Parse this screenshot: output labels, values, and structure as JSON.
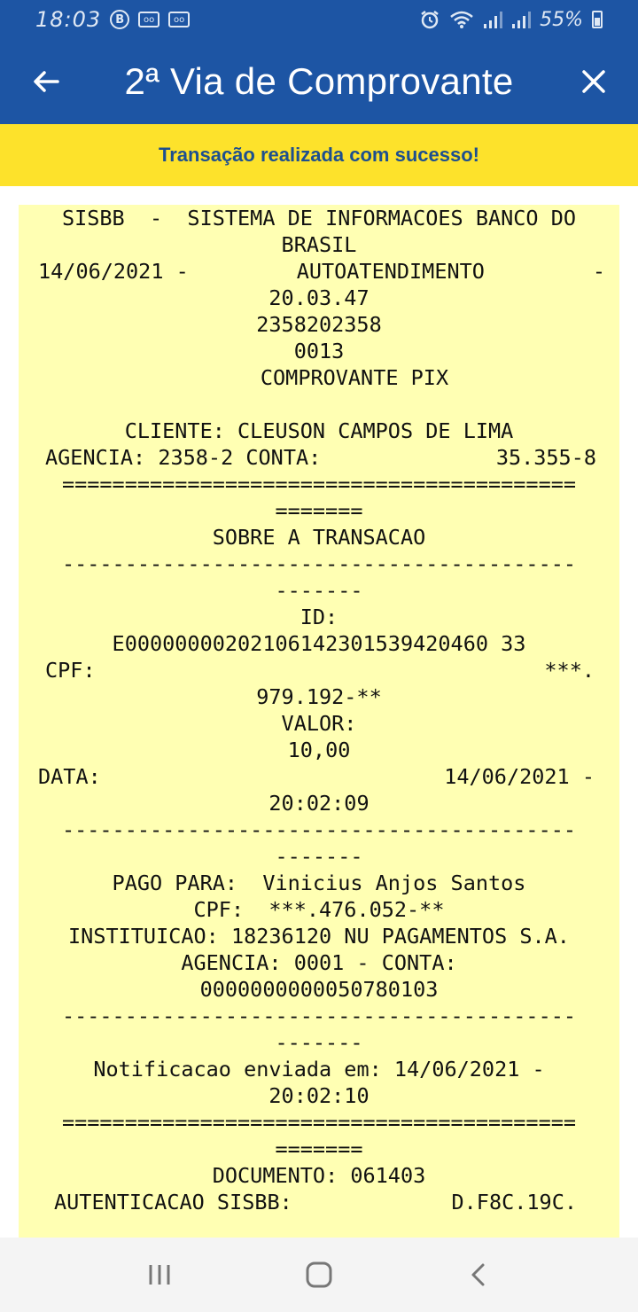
{
  "status_bar": {
    "time": "18:03",
    "battery": "55%",
    "icons": [
      "b-circle-icon",
      "voicemail-1-icon",
      "voicemail-2-icon",
      "alarm-icon",
      "wifi-icon",
      "signal-1-icon",
      "signal-2-icon",
      "battery-icon"
    ]
  },
  "header": {
    "title": "2ª Via de Comprovante",
    "back_icon": "arrow-left-icon",
    "close_icon": "close-icon",
    "bg_color": "#1d55a4"
  },
  "banner": {
    "text": "Transação realizada com sucesso!",
    "bg_color": "#fde22b",
    "text_color": "#1d4f8f"
  },
  "receipt": {
    "bg_color": "#ffffb3",
    "l01": "SISBB  -  SISTEMA DE INFORMACOES BANCO DO",
    "l02": "BRASIL",
    "l03a": "14/06/2021 -",
    "l03b": "AUTOATENDIMENTO",
    "l03c": "-",
    "l04": "20.03.47",
    "l05": "2358202358",
    "l06": "0013",
    "l07": "COMPROVANTE PIX",
    "l09": "CLIENTE: CLEUSON CAMPOS DE LIMA",
    "l10a": "AGENCIA: 2358-2 CONTA:",
    "l10b": "35.355-8",
    "l11": "=========================================",
    "l12": "=======",
    "l13": "SOBRE A TRANSACAO",
    "l14": "-----------------------------------------",
    "l15": "-------",
    "l16": "ID:",
    "l17": "E00000000202106142301539420460 33",
    "l18a": "CPF:",
    "l18b": "***.",
    "l19": "979.192-**",
    "l20": "VALOR:",
    "l21": "10,00",
    "l22a": "DATA:",
    "l22b": "14/06/2021 -",
    "l23": "20:02:09",
    "l24": "-----------------------------------------",
    "l25": "-------",
    "l26": "PAGO PARA:  Vinicius Anjos Santos",
    "l27": "CPF:  ***.476.052-**",
    "l28": "INSTITUICAO: 18236120 NU PAGAMENTOS S.A.",
    "l29": "AGENCIA: 0001 - CONTA:",
    "l30": "0000000000050780103",
    "l31": "-----------------------------------------",
    "l32": "-------",
    "l33": "Notificacao enviada em: 14/06/2021 -",
    "l34": "20:02:10",
    "l35": "=========================================",
    "l36": "=======",
    "l37": "DOCUMENTO: 061403",
    "l38a": "AUTENTICACAO SISBB:",
    "l38b": "D.F8C.19C."
  },
  "nav": {
    "recents_icon": "recents-icon",
    "home_icon": "home-icon",
    "back_icon": "back-chevron-icon"
  }
}
